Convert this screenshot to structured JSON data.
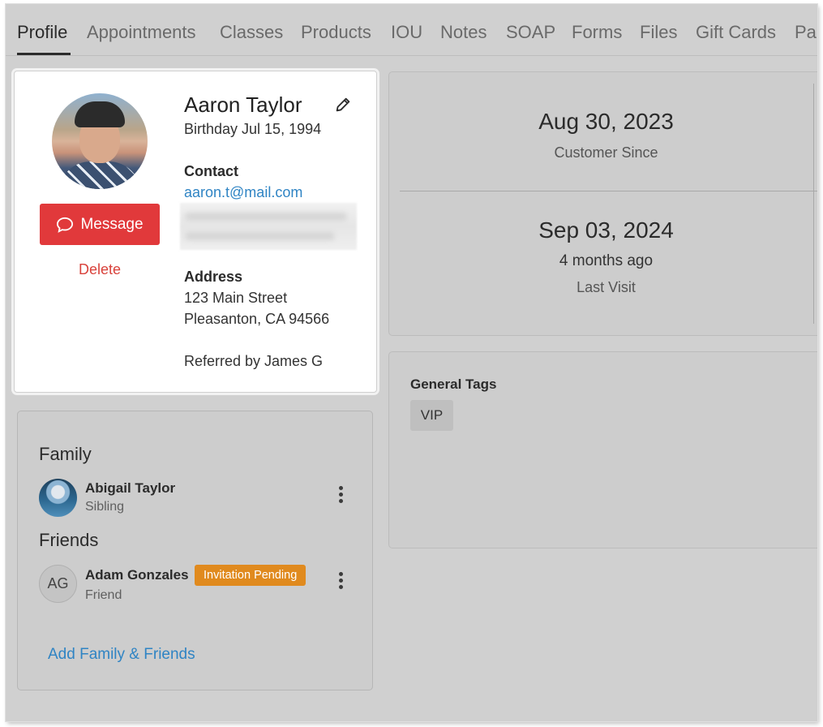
{
  "tabs": [
    {
      "label": "Profile",
      "active": true
    },
    {
      "label": "Appointments"
    },
    {
      "label": "Classes"
    },
    {
      "label": "Products"
    },
    {
      "label": "IOU"
    },
    {
      "label": "Notes"
    },
    {
      "label": "SOAP"
    },
    {
      "label": "Forms"
    },
    {
      "label": "Files"
    },
    {
      "label": "Gift Cards"
    },
    {
      "label": "Pa"
    }
  ],
  "profile": {
    "name": "Aaron Taylor",
    "birthday": "Birthday Jul 15, 1994",
    "message_label": "Message",
    "delete_label": "Delete",
    "contact_label": "Contact",
    "email": "aaron.t@mail.com",
    "address_label": "Address",
    "address_line1": "123 Main Street",
    "address_line2": "Pleasanton, CA 94566",
    "referred_by": "Referred by James G"
  },
  "stats": {
    "customer_since_date": "Aug 30, 2023",
    "customer_since_label": "Customer Since",
    "last_visit_date": "Sep 03, 2024",
    "last_visit_relative": "4 months ago",
    "last_visit_label": "Last Visit"
  },
  "tags": {
    "title": "General Tags",
    "items": [
      "VIP"
    ]
  },
  "family": {
    "family_title": "Family",
    "friends_title": "Friends",
    "members": [
      {
        "name": "Abigail Taylor",
        "relation": "Sibling"
      }
    ],
    "friends": [
      {
        "initials": "AG",
        "name": "Adam Gonzales",
        "relation": "Friend",
        "badge": "Invitation Pending"
      }
    ],
    "add_label": "Add Family & Friends"
  },
  "colors": {
    "accent_red": "#e1393b",
    "link_blue": "#2f84c4",
    "badge_orange": "#e08a1e"
  }
}
